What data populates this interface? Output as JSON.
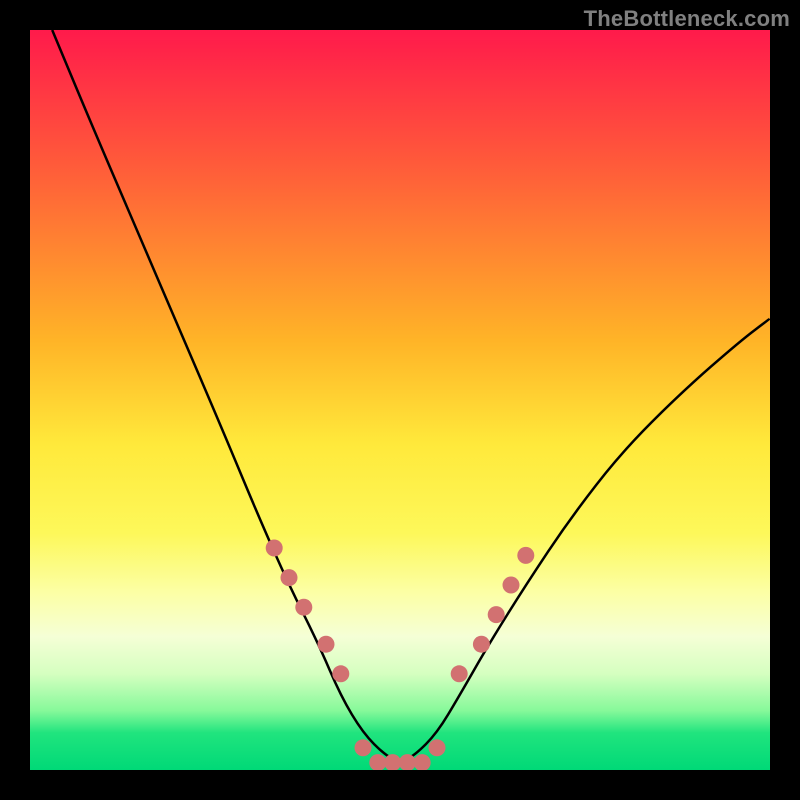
{
  "watermark": "TheBottleneck.com",
  "colors": {
    "frame": "#000000",
    "curve_stroke": "#000000",
    "marker_fill": "#d27171",
    "marker_stroke": "#b85a5a"
  },
  "chart_data": {
    "type": "line",
    "title": "",
    "xlabel": "",
    "ylabel": "",
    "xlim": [
      0,
      100
    ],
    "ylim": [
      0,
      100
    ],
    "legend": false,
    "grid": false,
    "series": [
      {
        "name": "bottleneck-curve",
        "x": [
          3,
          8,
          14,
          20,
          26,
          31,
          35,
          39,
          42,
          45,
          48,
          50,
          52,
          55,
          58,
          62,
          67,
          73,
          80,
          88,
          96,
          100
        ],
        "y": [
          100,
          88,
          74,
          60,
          46,
          34,
          25,
          17,
          10,
          5,
          2,
          1,
          2,
          5,
          10,
          17,
          25,
          34,
          43,
          51,
          58,
          61
        ]
      }
    ],
    "markers": {
      "name": "data-markers",
      "cluster_left": {
        "x": [
          33,
          35,
          37,
          40,
          42
        ],
        "y": [
          30,
          26,
          22,
          17,
          13
        ]
      },
      "cluster_floor": {
        "x": [
          45,
          47,
          49,
          51,
          53,
          55
        ],
        "y": [
          3,
          1,
          1,
          1,
          1,
          3
        ]
      },
      "cluster_right": {
        "x": [
          58,
          61,
          63,
          65,
          67
        ],
        "y": [
          13,
          17,
          21,
          25,
          29
        ]
      }
    },
    "gradient_bands_pct": [
      {
        "color": "#ff1a4b",
        "stop": 0
      },
      {
        "color": "#ff5a3a",
        "stop": 18
      },
      {
        "color": "#ffb427",
        "stop": 42
      },
      {
        "color": "#ffe93b",
        "stop": 56
      },
      {
        "color": "#fdf85a",
        "stop": 68
      },
      {
        "color": "#fcffa5",
        "stop": 76
      },
      {
        "color": "#f5ffd6",
        "stop": 82
      },
      {
        "color": "#d5ffc0",
        "stop": 87
      },
      {
        "color": "#86f99a",
        "stop": 92
      },
      {
        "color": "#20e47e",
        "stop": 95
      },
      {
        "color": "#00d977",
        "stop": 100
      }
    ]
  }
}
